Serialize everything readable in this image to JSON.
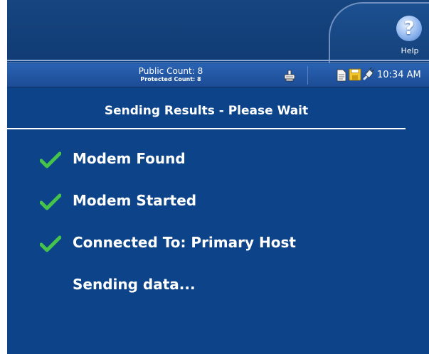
{
  "header": {
    "help": {
      "label": "Help",
      "icon": "help-icon"
    }
  },
  "status_bar": {
    "public_count": "Public Count: 8",
    "protected_count": "Protected Count: 8",
    "clock": "10:34 AM",
    "icons": [
      "printer-icon",
      "document-icon",
      "save-icon",
      "plug-icon"
    ]
  },
  "main": {
    "heading": "Sending Results - Please Wait",
    "steps": [
      {
        "label": "Modem Found",
        "done": true
      },
      {
        "label": "Modem Started",
        "done": true
      },
      {
        "label": "Connected To: Primary Host",
        "done": true
      },
      {
        "label": "Sending data...",
        "done": false
      }
    ]
  },
  "colors": {
    "background": "#0c4389",
    "status_bar": "#2a63b3",
    "check": "#3fbf3f",
    "text": "#ffffff"
  }
}
